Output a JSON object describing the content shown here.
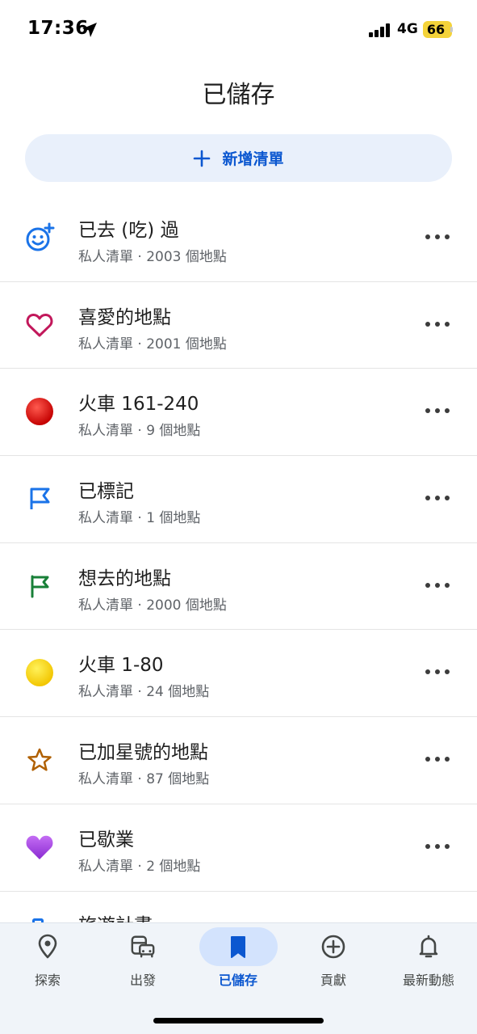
{
  "status_bar": {
    "time": "17:36",
    "network": "4G",
    "battery": "66"
  },
  "header": {
    "title": "已儲存",
    "new_list_label": "新增清單"
  },
  "lists": [
    {
      "icon": "smiley-add-icon",
      "title": "已去 (吃) 過",
      "subtitle": "私人清單 · 2003 個地點",
      "color": "#1a73e8"
    },
    {
      "icon": "heart-icon",
      "title": "喜愛的地點",
      "subtitle": "私人清單 · 2001 個地點",
      "color": "#c2185b"
    },
    {
      "icon": "red-circle-icon",
      "title": "火車 161-240",
      "subtitle": "私人清單 · 9 個地點",
      "color": "#d50000"
    },
    {
      "icon": "flag-outline-icon",
      "title": "已標記",
      "subtitle": "私人清單 · 1 個地點",
      "color": "#1a73e8"
    },
    {
      "icon": "green-flag-icon",
      "title": "想去的地點",
      "subtitle": "私人清單 · 2000 個地點",
      "color": "#188038"
    },
    {
      "icon": "yellow-circle-icon",
      "title": "火車 1-80",
      "subtitle": "私人清單 · 24 個地點",
      "color": "#f4c20d"
    },
    {
      "icon": "star-icon",
      "title": "已加星號的地點",
      "subtitle": "私人清單 · 87 個地點",
      "color": "#b06000"
    },
    {
      "icon": "purple-heart-icon",
      "title": "已歇業",
      "subtitle": "私人清單 · 2 個地點",
      "color": "#8e24aa"
    }
  ],
  "partial_item": {
    "title": "旅遊計畫"
  },
  "bottom_nav": {
    "tabs": [
      {
        "label": "探索",
        "icon": "location-pin-icon"
      },
      {
        "label": "出發",
        "icon": "commute-icon"
      },
      {
        "label": "已儲存",
        "icon": "bookmark-icon",
        "active": true
      },
      {
        "label": "貢獻",
        "icon": "add-circle-icon"
      },
      {
        "label": "最新動態",
        "icon": "bell-icon"
      }
    ]
  },
  "colors": {
    "accent": "#0b57d0",
    "button_bg": "#e9f0fb",
    "nav_bg": "#f0f4f9",
    "active_pill": "#d3e3fd"
  }
}
